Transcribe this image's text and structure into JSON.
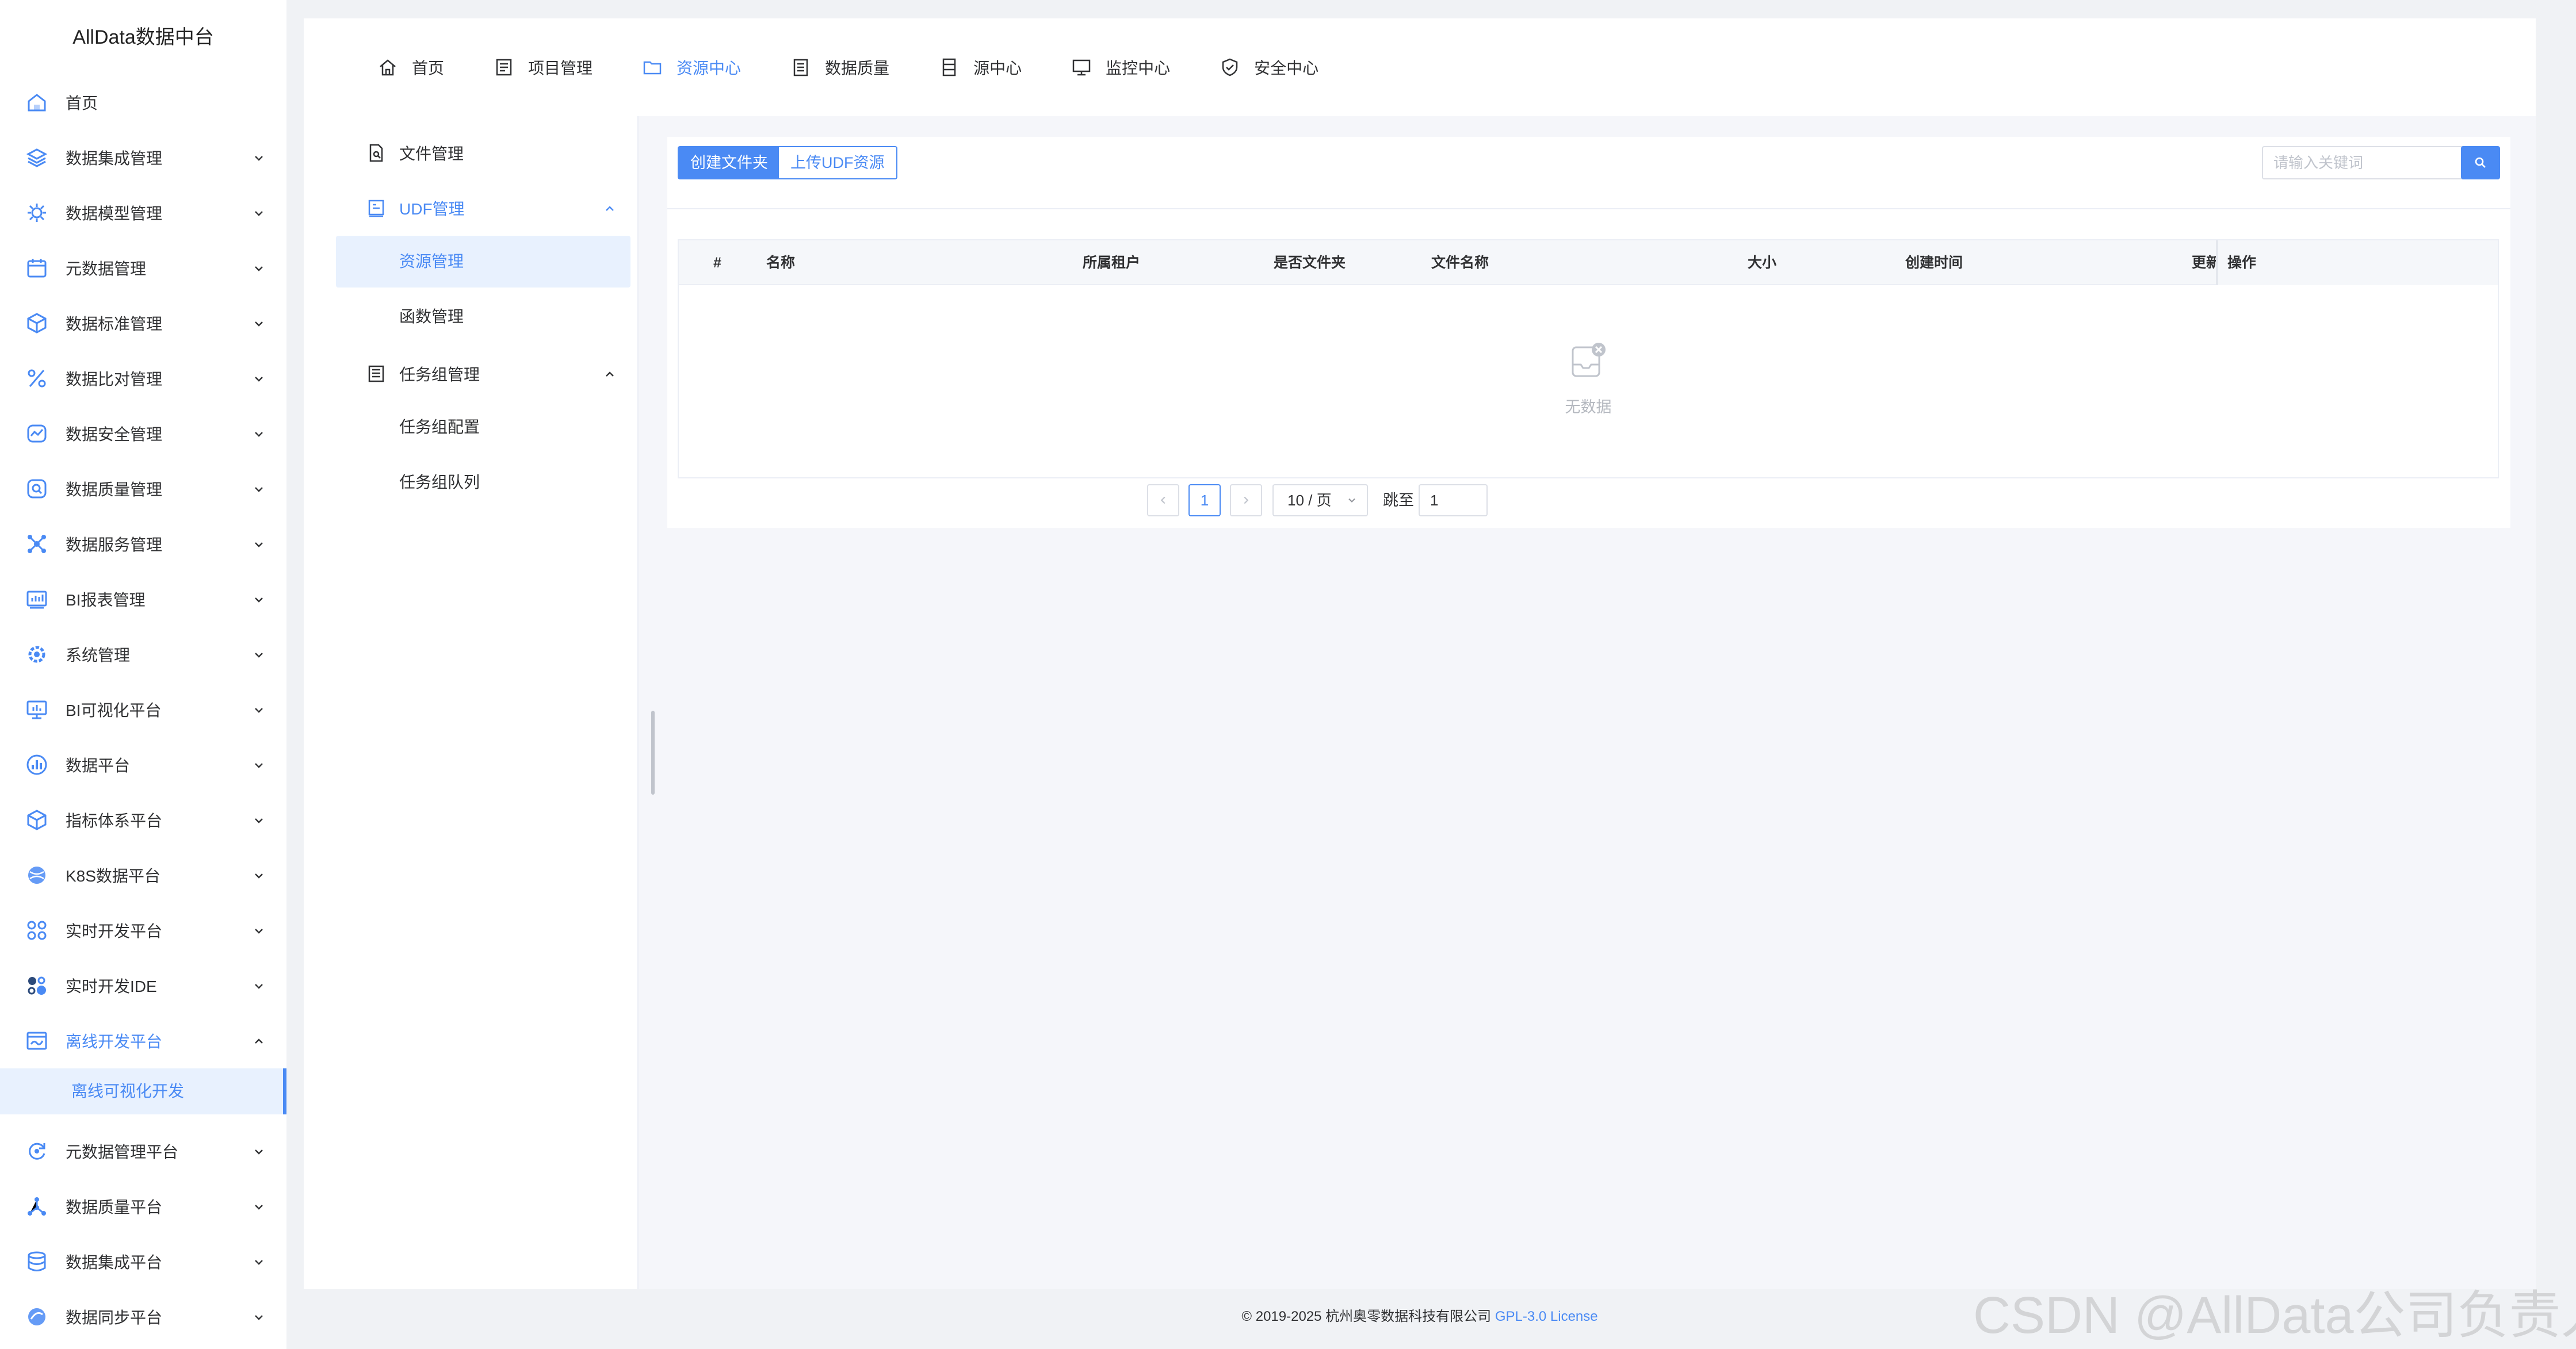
{
  "app": {
    "title": "AllData数据中台"
  },
  "sidebar": {
    "items": [
      {
        "label": "首页",
        "icon": "home-icon",
        "has_arrow": false
      },
      {
        "label": "数据集成管理",
        "icon": "layers-icon",
        "has_arrow": true
      },
      {
        "label": "数据模型管理",
        "icon": "model-icon",
        "has_arrow": true
      },
      {
        "label": "元数据管理",
        "icon": "calendar-icon",
        "has_arrow": true
      },
      {
        "label": "数据标准管理",
        "icon": "cube-icon",
        "has_arrow": true
      },
      {
        "label": "数据比对管理",
        "icon": "percent-icon",
        "has_arrow": true
      },
      {
        "label": "数据安全管理",
        "icon": "shield-chart-icon",
        "has_arrow": true
      },
      {
        "label": "数据质量管理",
        "icon": "quality-search-icon",
        "has_arrow": true
      },
      {
        "label": "数据服务管理",
        "icon": "service-icon",
        "has_arrow": true
      },
      {
        "label": "BI报表管理",
        "icon": "report-icon",
        "has_arrow": true
      },
      {
        "label": "系统管理",
        "icon": "system-icon",
        "has_arrow": true
      },
      {
        "label": "BI可视化平台",
        "icon": "monitor-icon",
        "has_arrow": true
      },
      {
        "label": "数据平台",
        "icon": "bar-chart-icon",
        "has_arrow": true
      },
      {
        "label": "指标体系平台",
        "icon": "box-icon",
        "has_arrow": true
      },
      {
        "label": "K8S数据平台",
        "icon": "globe-icon",
        "has_arrow": true
      },
      {
        "label": "实时开发平台",
        "icon": "nodes-icon",
        "has_arrow": true
      },
      {
        "label": "实时开发IDE",
        "icon": "ide-icon",
        "has_arrow": true
      },
      {
        "label": "离线开发平台",
        "icon": "offline-icon",
        "has_arrow": true,
        "expanded": true
      },
      {
        "label": "元数据管理平台",
        "icon": "refresh-icon",
        "has_arrow": true
      },
      {
        "label": "数据质量平台",
        "icon": "network-icon",
        "has_arrow": true
      },
      {
        "label": "数据集成平台",
        "icon": "database-icon",
        "has_arrow": true
      },
      {
        "label": "数据同步平台",
        "icon": "sync-icon",
        "has_arrow": true
      }
    ],
    "active_sub": "离线可视化开发"
  },
  "topnav": {
    "items": [
      {
        "label": "首页",
        "icon": "home-icon"
      },
      {
        "label": "项目管理",
        "icon": "project-icon"
      },
      {
        "label": "资源中心",
        "icon": "folder-icon",
        "active": true
      },
      {
        "label": "数据质量",
        "icon": "clipboard-icon"
      },
      {
        "label": "源中心",
        "icon": "server-icon"
      },
      {
        "label": "监控中心",
        "icon": "monitor-icon"
      },
      {
        "label": "安全中心",
        "icon": "shield-check-icon"
      }
    ]
  },
  "submenu": {
    "file_mgmt": "文件管理",
    "udf_mgmt": "UDF管理",
    "udf_children": [
      "资源管理",
      "函数管理"
    ],
    "taskgroup_mgmt": "任务组管理",
    "taskgroup_children": [
      "任务组配置",
      "任务组队列"
    ]
  },
  "toolbar": {
    "create_folder": "创建文件夹",
    "upload_udf": "上传UDF资源",
    "search_placeholder": "请输入关键词"
  },
  "table": {
    "columns": [
      "#",
      "名称",
      "所属租户",
      "是否文件夹",
      "文件名称",
      "大小",
      "创建时间",
      "更新",
      "操作"
    ],
    "rows": [],
    "empty_text": "无数据"
  },
  "pagination": {
    "current_page": "1",
    "page_size": "10 / 页",
    "jump_label": "跳至",
    "jump_value": "1"
  },
  "footer": {
    "copyright": "© 2019-2025 杭州奥零数据科技有限公司",
    "license": "GPL-3.0 License"
  },
  "watermark": "CSDN @AllData公司负责人",
  "colors": {
    "accent": "#4a8af4",
    "active_bg": "#e8f1fe"
  }
}
